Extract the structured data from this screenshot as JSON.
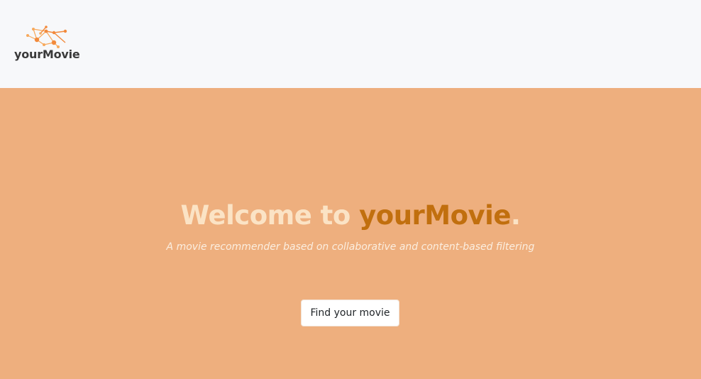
{
  "colors": {
    "navbar_bg": "#f7f8fa",
    "hero_bg": "#eeaf7e",
    "title_text": "#fbe3c5",
    "title_accent": "#c16f0e",
    "subtitle_text": "#fbeee0",
    "logo_orange": "#f28a3c",
    "logo_light": "#f7a95c"
  },
  "navbar": {
    "brand_name": "yourMovie",
    "logo_icon": "network-nodes-icon"
  },
  "hero": {
    "title_prefix": "Welcome to ",
    "title_accent": "yourMovie",
    "title_suffix": ".",
    "subtitle": "A movie recommender based on collaborative and content-based filtering",
    "button_label": "Find your movie"
  }
}
